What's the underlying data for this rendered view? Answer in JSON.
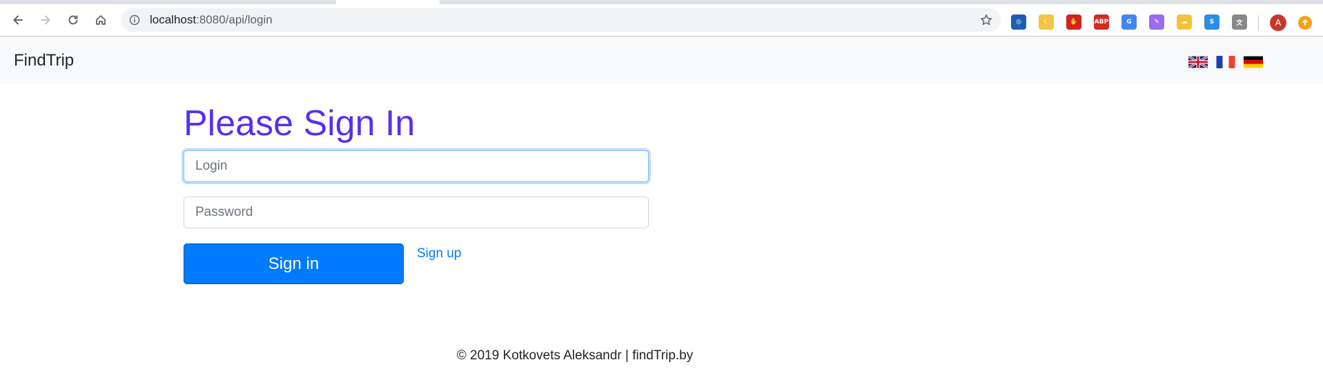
{
  "browser": {
    "url_host": "localhost",
    "url_rest": ":8080/api/login",
    "profile_initial": "A",
    "extensions": [
      {
        "name": "tracker-icon",
        "color": "#1a5fb4",
        "glyph": "◎"
      },
      {
        "name": "moon-icon",
        "color": "#f6c343",
        "glyph": "☾"
      },
      {
        "name": "ublock-icon",
        "color": "#d4221c",
        "glyph": "✋"
      },
      {
        "name": "adblock-plus-icon",
        "color": "#d42a24",
        "glyph": "ABP"
      },
      {
        "name": "google-translate-icon",
        "color": "#4285f4",
        "glyph": "G"
      },
      {
        "name": "quill-icon",
        "color": "#9a6cf2",
        "glyph": "✎"
      },
      {
        "name": "cloud-download-icon",
        "color": "#f6c23a",
        "glyph": "☁"
      },
      {
        "name": "skype-s-icon",
        "color": "#2a8de6",
        "glyph": "S"
      },
      {
        "name": "translate-icon",
        "color": "#888888",
        "glyph": "文"
      }
    ]
  },
  "navbar": {
    "brand": "FindTrip",
    "flags": [
      "flag-uk-icon",
      "flag-france-icon",
      "flag-germany-icon"
    ]
  },
  "form": {
    "heading": "Please Sign In",
    "login_placeholder": "Login",
    "password_placeholder": "Password",
    "signin_label": "Sign in",
    "signup_label": "Sign up"
  },
  "footer": {
    "text": "© 2019 Kotkovets Aleksandr | findTrip.by"
  },
  "colors": {
    "heading": "#5530f2",
    "primary": "#007bff",
    "navbar_bg": "#f8f9fa"
  }
}
